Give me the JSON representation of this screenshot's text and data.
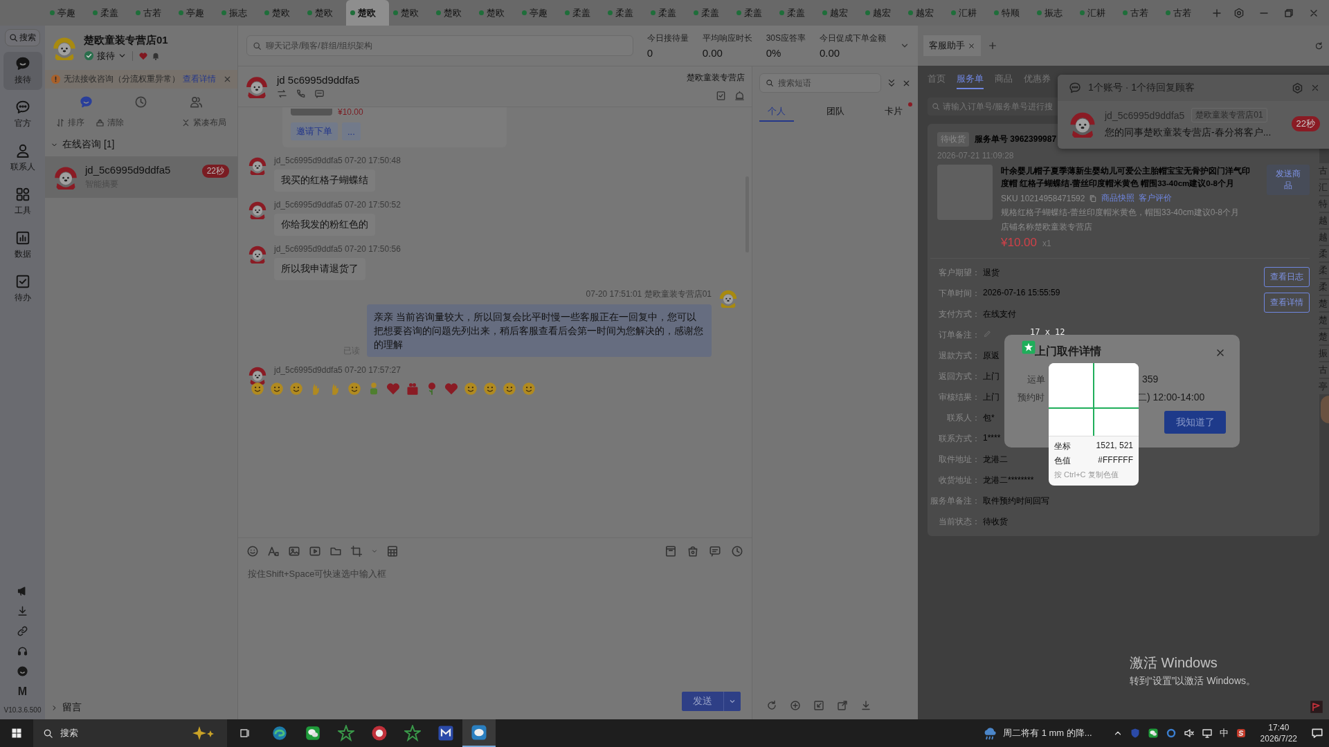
{
  "top_tabs": [
    {
      "label": "亭趣",
      "selected": false
    },
    {
      "label": "柔盖",
      "selected": false
    },
    {
      "label": "古若",
      "selected": false
    },
    {
      "label": "亭趣",
      "selected": false
    },
    {
      "label": "振志",
      "selected": false
    },
    {
      "label": "楚欧",
      "selected": false
    },
    {
      "label": "楚欧",
      "selected": false
    },
    {
      "label": "楚欧",
      "selected": true
    },
    {
      "label": "楚欧",
      "selected": false
    },
    {
      "label": "楚欧",
      "selected": false
    },
    {
      "label": "楚欧",
      "selected": false
    },
    {
      "label": "亭趣",
      "selected": false
    },
    {
      "label": "柔盖",
      "selected": false
    },
    {
      "label": "柔盖",
      "selected": false
    },
    {
      "label": "柔盖",
      "selected": false
    },
    {
      "label": "柔盖",
      "selected": false
    },
    {
      "label": "柔盖",
      "selected": false
    },
    {
      "label": "柔盖",
      "selected": false
    },
    {
      "label": "越宏",
      "selected": false
    },
    {
      "label": "越宏",
      "selected": false
    },
    {
      "label": "越宏",
      "selected": false
    },
    {
      "label": "汇耕",
      "selected": false
    },
    {
      "label": "特顺",
      "selected": false
    },
    {
      "label": "振志",
      "selected": false
    },
    {
      "label": "汇耕",
      "selected": false
    },
    {
      "label": "古若",
      "selected": false
    },
    {
      "label": "古若",
      "selected": false
    }
  ],
  "nav": {
    "search": "搜索",
    "items": [
      {
        "label": "接待",
        "kind": "chat",
        "selected": true
      },
      {
        "label": "官方",
        "kind": "bubble",
        "selected": false
      },
      {
        "label": "联系人",
        "kind": "person",
        "selected": false
      },
      {
        "label": "工具",
        "kind": "grid",
        "selected": false
      },
      {
        "label": "数据",
        "kind": "chart",
        "selected": false
      },
      {
        "label": "待办",
        "kind": "todo",
        "selected": false
      }
    ],
    "bottom": [
      {
        "kind": "megaphone"
      },
      {
        "kind": "download"
      },
      {
        "kind": "link"
      },
      {
        "kind": "headset"
      },
      {
        "kind": "smiley"
      },
      {
        "kind": "letter",
        "label": "M"
      }
    ],
    "version": "V10.3.6.500"
  },
  "account": {
    "name": "楚欧童装专营店01",
    "status": "接待"
  },
  "alert": {
    "text": "无法接收咨询（分流权重异常）",
    "link": "查看详情"
  },
  "list_tabs": [
    {
      "kind": "chat",
      "selected": true
    },
    {
      "kind": "clock",
      "selected": false
    },
    {
      "kind": "people",
      "selected": false
    }
  ],
  "list_actions": [
    {
      "kind": "sort",
      "label": "排序"
    },
    {
      "kind": "clear",
      "label": "清除"
    },
    {
      "kind": "compact",
      "label": "紧凑布局"
    }
  ],
  "groups": [
    {
      "title": "在线咨询 [1]",
      "expanded": true,
      "sessions": [
        {
          "name": "jd_5c6995d9ddfa5",
          "summary": "智能摘要",
          "badge": "22秒",
          "selected": true
        }
      ]
    },
    {
      "title": "留言",
      "expanded": false
    }
  ],
  "header": {
    "search_placeholder": "聊天记录/顾客/群组/组织架构",
    "stats": [
      {
        "label": "今日接待量",
        "value": "0"
      },
      {
        "label": "平均响应时长",
        "value": "0.00"
      },
      {
        "label": "30S应答率",
        "value": "0%"
      },
      {
        "label": "今日促成下单金额",
        "value": "0.00"
      }
    ]
  },
  "chat": {
    "title": "jd 5c6995d9ddfa5",
    "shop": "楚欧童装专营店",
    "card": {
      "price": "¥10.00",
      "actions": [
        "邀请下单",
        "..."
      ]
    },
    "messages": [
      {
        "kind": "in",
        "sender": "jd_5c6995d9ddfa5",
        "time": "07-20 17:50:48",
        "text": "我买的红格子蝴蝶结"
      },
      {
        "kind": "in",
        "sender": "jd_5c6995d9ddfa5",
        "time": "07-20 17:50:52",
        "text": "你给我发的粉红色的"
      },
      {
        "kind": "in",
        "sender": "jd_5c6995d9ddfa5",
        "time": "07-20 17:50:56",
        "text": "所以我申请退货了"
      },
      {
        "kind": "out",
        "sender": "楚欧童装专营店01",
        "time": "07-20 17:51:01",
        "text": "亲亲  当前咨询量较大，所以回复会比平时慢一些客服正在一回复中，您可以把想要咨询的问题先列出来，稍后客服查看后会第一时间为您解决的，感谢您的理解",
        "receipt": "已读"
      },
      {
        "kind": "emoji",
        "sender": "jd_5c6995d9ddfa5",
        "time": "07-20 17:57:27",
        "emojis": [
          {
            "kind": "face"
          },
          {
            "kind": "face"
          },
          {
            "kind": "face"
          },
          {
            "kind": "hand"
          },
          {
            "kind": "hand"
          },
          {
            "kind": "face"
          },
          {
            "kind": "figure"
          },
          {
            "kind": "heart"
          },
          {
            "kind": "gift"
          },
          {
            "kind": "flower"
          },
          {
            "kind": "heart"
          },
          {
            "kind": "face"
          },
          {
            "kind": "face"
          },
          {
            "kind": "face"
          },
          {
            "kind": "face"
          }
        ]
      }
    ],
    "input_placeholder": "按住Shift+Space可快速选中输入框",
    "send": "发送"
  },
  "phrases": {
    "search_placeholder": "搜索短语",
    "tabs": [
      {
        "label": "个人",
        "selected": true,
        "dot": false
      },
      {
        "label": "团队",
        "selected": false,
        "dot": false
      },
      {
        "label": "卡片",
        "selected": false,
        "dot": true
      }
    ]
  },
  "assistant": {
    "tab": "客服助手",
    "nav": [
      {
        "label": "首页",
        "selected": false
      },
      {
        "label": "服务单",
        "selected": true
      },
      {
        "label": "商品",
        "selected": false
      },
      {
        "label": "优惠券",
        "selected": false
      }
    ],
    "search_placeholder": "请输入订单号/服务单号进行搜",
    "order": {
      "status": "待收货",
      "number": "服务单号 3962399987",
      "date": "2026-07-21 11:09:28",
      "title": "叶余婴儿帽子夏季薄新生婴幼儿可爱公主胎帽宝宝无骨护囟门洋气印度帽 红格子蝴蝶结-蕾丝印度帽米黄色 帽围33-40cm建议0-8个月",
      "sku": "SKU 10214958471592",
      "links": [
        "商品快照",
        "客户评价"
      ],
      "spec": "规格红格子蝴蝶结-蕾丝印度帽米黄色，帽围33-40cm建议0-8个月",
      "store": "店铺名称楚欧童装专营店",
      "price": "¥10.00",
      "qty": "x1",
      "send": "发送商品",
      "fields": [
        {
          "label": "客户期望：",
          "value": "退货"
        },
        {
          "label": "下单时间：",
          "value": "2026-07-16 15:55:59"
        },
        {
          "label": "支付方式：",
          "value": "在线支付"
        },
        {
          "label": "订单备注：",
          "kind": "edit"
        },
        {
          "label": "退款方式：",
          "value": "原返"
        },
        {
          "label": "返回方式：",
          "value": "上门"
        },
        {
          "label": "审核结果：",
          "value": "上门"
        },
        {
          "label": "联系人：",
          "value": "包*"
        },
        {
          "label": "联系方式：",
          "value": "1****"
        },
        {
          "label": "取件地址：",
          "value": "龙港二"
        },
        {
          "label": "收货地址：",
          "value": "龙港二********"
        },
        {
          "label": "服务单备注：",
          "value": "取件预约时间回写"
        },
        {
          "label": "当前状态：",
          "value": "待收货"
        }
      ],
      "buttons": [
        "查看日志",
        "查看详情"
      ]
    }
  },
  "notification": {
    "title": "1个账号 · 1个待回复顾客",
    "name": "jd_5c6995d9ddfa5",
    "tag": "楚欧童装专营店01",
    "message": "您的同事楚欧童装专营店-春分将客户...",
    "badge": "22秒"
  },
  "dialog": {
    "title": "上门取件详情",
    "rows": [
      {
        "label": "运单",
        "value": "359"
      },
      {
        "label": "预约时",
        "value": "二) 12:00-14:00"
      }
    ],
    "button": "我知道了"
  },
  "color_picker": {
    "size": "17 x 12",
    "coord_label": "坐标",
    "coord": "1521, 521",
    "color_label": "色值",
    "color_value": "#FFFFFF",
    "hint": "按 Ctrl+C 复制色值"
  },
  "edge_tabs": [
    "古",
    "汇",
    "特",
    "越",
    "越",
    "柔",
    "柔",
    "柔",
    "楚",
    "楚",
    "楚",
    "振",
    "古",
    "亭"
  ],
  "activation": {
    "title": "激活 Windows",
    "subtitle": "转到“设置”以激活 Windows。"
  },
  "taskbar": {
    "search": "搜索",
    "apps": [
      {
        "kind": "browser",
        "selected": false
      },
      {
        "kind": "chat",
        "selected": false
      },
      {
        "kind": "star",
        "selected": false
      },
      {
        "kind": "red",
        "selected": false
      },
      {
        "kind": "star",
        "selected": false
      },
      {
        "kind": "square",
        "selected": false
      },
      {
        "kind": "bird",
        "selected": true
      }
    ],
    "weather": "周二将有 1 mm 的降...",
    "ime": "中",
    "time": "17:40",
    "date": "2026/7/22"
  }
}
